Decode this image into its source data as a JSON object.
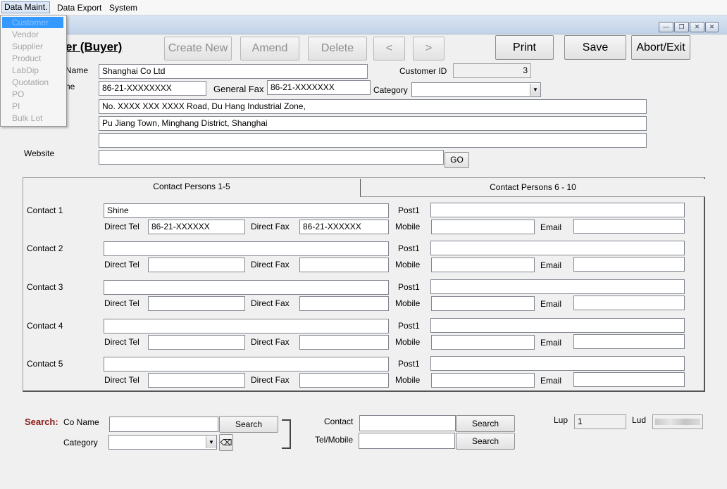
{
  "menu": {
    "data_maint": "Data Maint.",
    "data_export": "Data Export",
    "system": "System"
  },
  "dropdown": [
    "Customer",
    "Vendor",
    "Supplier",
    "Product",
    "LabDip",
    "Quotation",
    "PO",
    "PI",
    "Bulk Lot"
  ],
  "form_title": "er (Buyer)",
  "toolbar": {
    "create_new": "Create New",
    "amend": "Amend",
    "delete": "Delete",
    "prev": "<",
    "next": ">",
    "print": "Print",
    "save": "Save",
    "abort": "Abort/Exit"
  },
  "company": {
    "name_label": "Name",
    "name_value": "Shanghai Co Ltd",
    "customer_id_label": "Customer ID",
    "customer_id": "3",
    "tel_label": "ne",
    "tel_value": "86-21-XXXXXXXX",
    "fax_label": "General Fax",
    "fax_value": "86-21-XXXXXXX",
    "category_label": "Category",
    "category_value": "",
    "address1": "No. XXXX XXX XXXX Road, Du Hang Industrial Zone,",
    "address2": "Pu Jiang Town, Minghang District, Shanghai",
    "address3": "",
    "website_label": "Website",
    "website_value": "",
    "go_label": "GO"
  },
  "tabs": {
    "tab1": "Contact Persons 1-5",
    "tab2": "Contact Persons 6 - 10"
  },
  "contact_labels": {
    "direct_tel": "Direct Tel",
    "direct_fax": "Direct Fax",
    "mobile": "Mobile",
    "email": "Email"
  },
  "contacts": [
    {
      "label": "Contact 1",
      "name": "Shine",
      "post_label": "Post1",
      "post": "",
      "tel": "86-21-XXXXXX",
      "fax": "86-21-XXXXXX",
      "mobile": "",
      "email": ""
    },
    {
      "label": "Contact 2",
      "name": "",
      "post_label": "Post1",
      "post": "",
      "tel": "",
      "fax": "",
      "mobile": "",
      "email": ""
    },
    {
      "label": "Contact 3",
      "name": "",
      "post_label": "Post1",
      "post": "",
      "tel": "",
      "fax": "",
      "mobile": "",
      "email": ""
    },
    {
      "label": "Contact 4",
      "name": "",
      "post_label": "Post1",
      "post": "",
      "tel": "",
      "fax": "",
      "mobile": "",
      "email": ""
    },
    {
      "label": "Contact 5",
      "name": "",
      "post_label": "Post1",
      "post": "",
      "tel": "",
      "fax": "",
      "mobile": "",
      "email": ""
    }
  ],
  "search": {
    "title": "Search:",
    "co_name_label": "Co Name",
    "category_label": "Category",
    "contact_label": "Contact",
    "tel_mobile_label": "Tel/Mobile",
    "search_btn": "Search",
    "co_name_value": "",
    "category_value": "",
    "contact_value": "",
    "tel_mobile_value": ""
  },
  "status": {
    "lup_label": "Lup",
    "lup_value": "1",
    "lud_label": "Lud"
  },
  "colors": {
    "search_title": "#8b1a1a",
    "highlight": "#3399ff"
  }
}
